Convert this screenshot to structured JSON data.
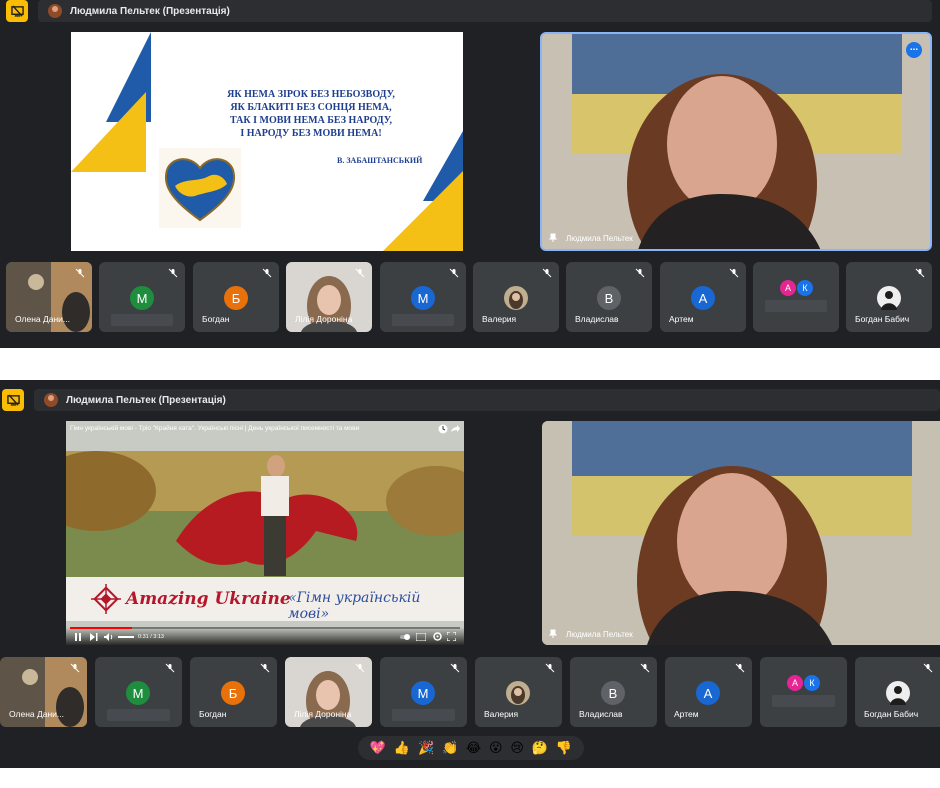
{
  "presenter_bar": {
    "label": "Людмила Пельтек (Презентація)"
  },
  "slide": {
    "poem_lines": [
      "ЯК НЕМА ЗІРОК БЕЗ НЕБОЗВОДУ,",
      "ЯК БЛАКИТІ БЕЗ СОНЦЯ НЕМА,",
      "ТАК І МОВИ НЕМА БЕЗ НАРОДУ,",
      "І НАРОДУ БЕЗ МОВИ НЕМА!"
    ],
    "author": "В. ЗАБАШТАНСЬКИЙ"
  },
  "speaker": {
    "name": "Людмила Пельтек"
  },
  "more_button": {
    "label": "..."
  },
  "participants": [
    {
      "name": "Олена Дани...",
      "type": "video"
    },
    {
      "name": "",
      "initial": "М",
      "color": "#1e8e3e"
    },
    {
      "name": "Богдан",
      "initial": "Б",
      "color": "#e8710a"
    },
    {
      "name": "Лілія Дороніна",
      "type": "video"
    },
    {
      "name": "",
      "initial": "М",
      "color": "#1967d2"
    },
    {
      "name": "Валерия",
      "type": "photo"
    },
    {
      "name": "Владислав",
      "initial": "В",
      "color": "#5f6368"
    },
    {
      "name": "Артем",
      "initial": "А",
      "color": "#1967d2"
    },
    {
      "name": "",
      "initials": [
        "А",
        "К"
      ],
      "colors": [
        "#e52592",
        "#1a73e8"
      ]
    },
    {
      "name": "Богдан Бабич",
      "type": "photo"
    }
  ],
  "video": {
    "title": "Гімн українській мові - Тріо \"Крайня хата\". Українські пісні | День української писемності та мови",
    "brand": "Amazing Ukraine",
    "caption": "«Гімн українській мові»",
    "time": "0:31 / 3:13"
  },
  "reactions": [
    "💖",
    "👍",
    "🎉",
    "👏",
    "😂",
    "😮",
    "😢",
    "🤔",
    "👎"
  ],
  "colors": {
    "bg": "#202124",
    "tile": "#3c4043",
    "accent": "#fbbc04",
    "blue": "#1a73e8",
    "ua_blue": "#1f5ba8",
    "ua_yellow": "#f5c016"
  }
}
